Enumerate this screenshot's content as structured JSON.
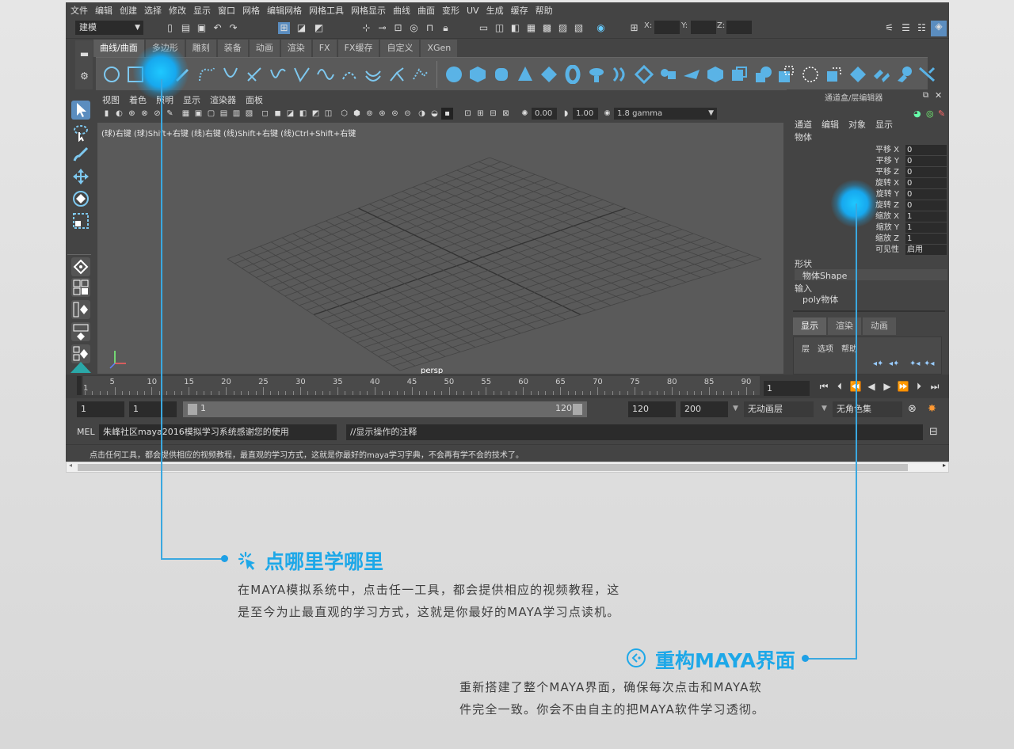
{
  "menubar": [
    "文件",
    "编辑",
    "创建",
    "选择",
    "修改",
    "显示",
    "窗口",
    "网格",
    "编辑网格",
    "网格工具",
    "网格显示",
    "曲线",
    "曲面",
    "变形",
    "UV",
    "生成",
    "缓存",
    "帮助"
  ],
  "status_line": {
    "mode": "建模",
    "x_label": "X:",
    "y_label": "Y:",
    "z_label": "Z:"
  },
  "shelf_tabs": [
    "曲线/曲面",
    "多边形",
    "雕刻",
    "装备",
    "动画",
    "渲染",
    "FX",
    "FX缓存",
    "自定义",
    "XGen"
  ],
  "viewport": {
    "menu": [
      "视图",
      "着色",
      "照明",
      "显示",
      "渲染器",
      "面板"
    ],
    "field1": "0.00",
    "field2": "1.00",
    "gamma": "1.8 gamma",
    "hint": "(球)右键 (球)Shift+右键 (线)右键 (线)Shift+右键 (线)Ctrl+Shift+右键",
    "camera": "persp"
  },
  "channel_box": {
    "title": "通道盒/层编辑器",
    "menu": [
      "通道",
      "编辑",
      "对象",
      "显示"
    ],
    "object": "物体",
    "attributes": [
      {
        "name": "平移 X",
        "value": "0"
      },
      {
        "name": "平移 Y",
        "value": "0"
      },
      {
        "name": "平移 Z",
        "value": "0"
      },
      {
        "name": "旋转 X",
        "value": "0"
      },
      {
        "name": "旋转 Y",
        "value": "0"
      },
      {
        "name": "旋转 Z",
        "value": "0"
      },
      {
        "name": "缩放 X",
        "value": "1"
      },
      {
        "name": "缩放 Y",
        "value": "1"
      },
      {
        "name": "缩放 Z",
        "value": "1"
      },
      {
        "name": "可见性",
        "value": "启用"
      }
    ],
    "shapes_label": "形状",
    "shape_name": "物体Shape",
    "inputs_label": "输入",
    "input_name": "poly物体",
    "layer_tabs": [
      "显示",
      "渲染",
      "动画"
    ],
    "layer_menu": [
      "层",
      "选项",
      "帮助"
    ]
  },
  "timeline": {
    "ticks": [
      "1",
      "5",
      "10",
      "15",
      "20",
      "25",
      "30",
      "35",
      "40",
      "45",
      "50",
      "55",
      "60",
      "65",
      "70",
      "75",
      "80",
      "85",
      "90"
    ],
    "current_frame": "1"
  },
  "range": {
    "start": "1",
    "anim_start": "1",
    "slider_start": "1",
    "slider_end": "120",
    "end": "120",
    "anim_end": "200",
    "anim_layer": "无动画层",
    "char_set": "无角色集"
  },
  "command": {
    "lang": "MEL",
    "input": "朱峰社区maya2016模拟学习系统感谢您的使用",
    "output": "//显示操作的注释"
  },
  "help_line": "点击任何工具，都会提供相应的视频教程，最直观的学习方式，这就是你最好的maya学习字典，不会再有学不会的技术了。",
  "callout1": {
    "title": "点哪里学哪里",
    "line1": "在MAYA模拟系统中，点击任一工具，都会提供相应的视频教程，这",
    "line2": "是至今为止最直观的学习方式，这就是你最好的MAYA学习点读机。"
  },
  "callout2": {
    "title": "重构MAYA界面",
    "line1": "重新搭建了整个MAYA界面，确保每次点击和MAYA软",
    "line2": "件完全一致。你会不由自主的把MAYA软件学习透彻。"
  },
  "colors": {
    "accent": "#1ea8e8",
    "panel": "#444444",
    "viewport": "#5a5a5a"
  }
}
